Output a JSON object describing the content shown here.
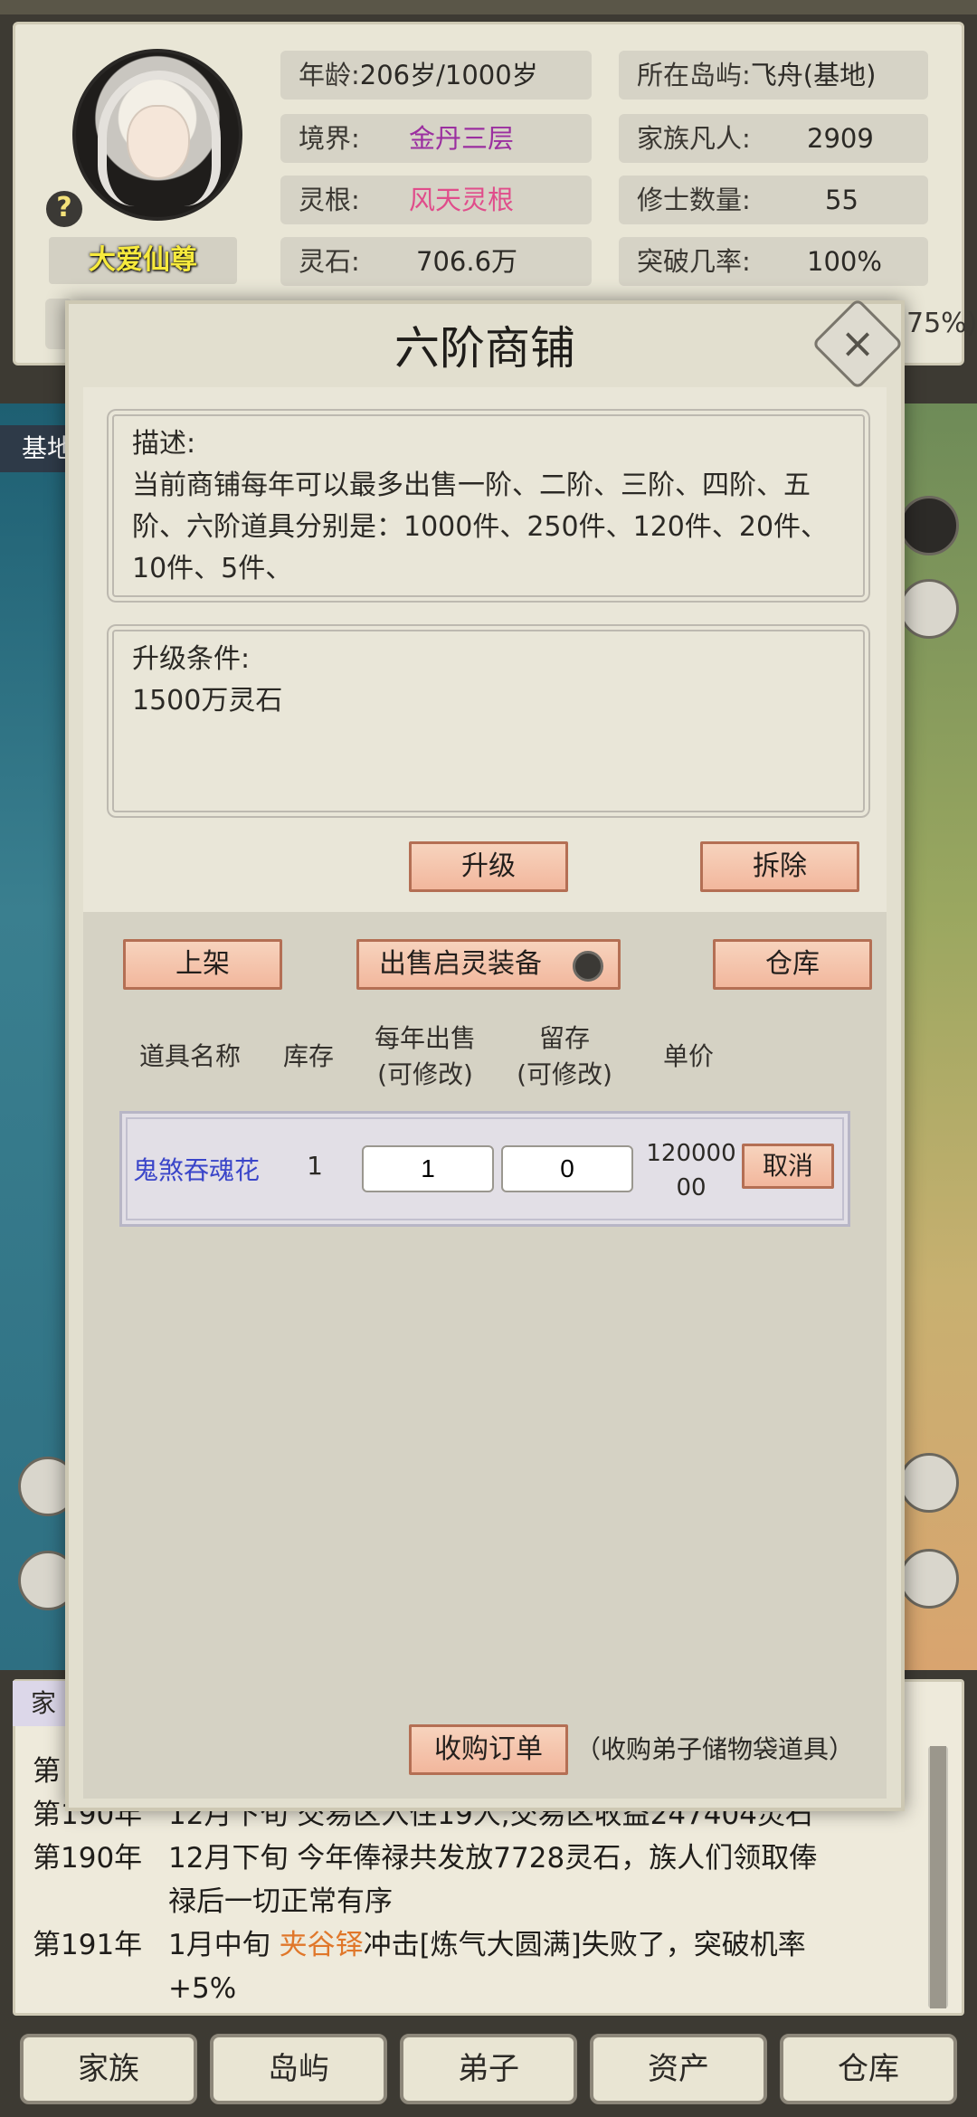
{
  "player": {
    "name": "大爱仙尊",
    "help_icon": "?"
  },
  "stats": {
    "age_label": "年龄:",
    "age_value": "206岁/1000岁",
    "realm_label": "境界:",
    "realm_value": "金丹三层",
    "root_label": "灵根:",
    "root_value": "风天灵根",
    "stone_label": "灵石:",
    "stone_value": "706.6万",
    "island_label": "所在岛屿:",
    "island_value": "飞舟(基地)",
    "mortals_label": "家族凡人:",
    "mortals_value": "2909",
    "cultivators_label": "修士数量:",
    "cultivators_value": "55",
    "breakthrough_label": "突破几率:",
    "breakthrough_value": "100%",
    "partial_pct": "75%)"
  },
  "map": {
    "base_label": "基地"
  },
  "modal": {
    "title": "六阶商铺",
    "close_icon": "×",
    "description_title": "描述:",
    "description_text": "当前商铺每年可以最多出售一阶、二阶、三阶、四阶、五阶、六阶道具分别是：1000件、250件、120件、20件、10件、5件、",
    "upgrade_title": "升级条件:",
    "upgrade_text": "1500万灵石",
    "upgrade_button": "升级",
    "demolish_button": "拆除",
    "list_button": "上架",
    "sell_equipment_toggle": "出售启灵装备",
    "warehouse_button": "仓库",
    "columns": {
      "name": "道具名称",
      "stock": "库存",
      "annual_sell_1": "每年出售",
      "annual_sell_2": "(可修改)",
      "reserve_1": "留存",
      "reserve_2": "(可修改)",
      "price": "单价"
    },
    "items": [
      {
        "name": "鬼煞吞魂花",
        "stock": "1",
        "annual_sell": "1",
        "reserve": "0",
        "price_line1": "120000",
        "price_line2": "00",
        "action": "取消"
      }
    ],
    "order_button": "收购订单",
    "order_note": "（收购弟子储物袋道具）"
  },
  "log": {
    "tab_label": "家",
    "entries": [
      {
        "year": "第",
        "text": ""
      },
      {
        "year": "第190年",
        "text": "12月下旬 交易区入住19人,交易区收益247404灵石"
      },
      {
        "year": "第190年",
        "text": "12月下旬 今年俸禄共发放7728灵石，族人们领取俸"
      },
      {
        "year": "",
        "text": "禄后一切正常有序"
      },
      {
        "year": "第191年",
        "prefix": "1月中旬 ",
        "highlight": "夹谷铎",
        "suffix": "冲击[炼气大圆满]失败了，突破机率"
      },
      {
        "year": "",
        "text": "+5%"
      }
    ]
  },
  "tabs": [
    "家族",
    "岛屿",
    "弟子",
    "资产",
    "仓库"
  ],
  "colors": {
    "realm": "#9b2fa0",
    "root": "#e04d8b",
    "item_name": "#3a45c9",
    "highlight_name": "#e0772a",
    "button_fill": "#f2b79d"
  }
}
